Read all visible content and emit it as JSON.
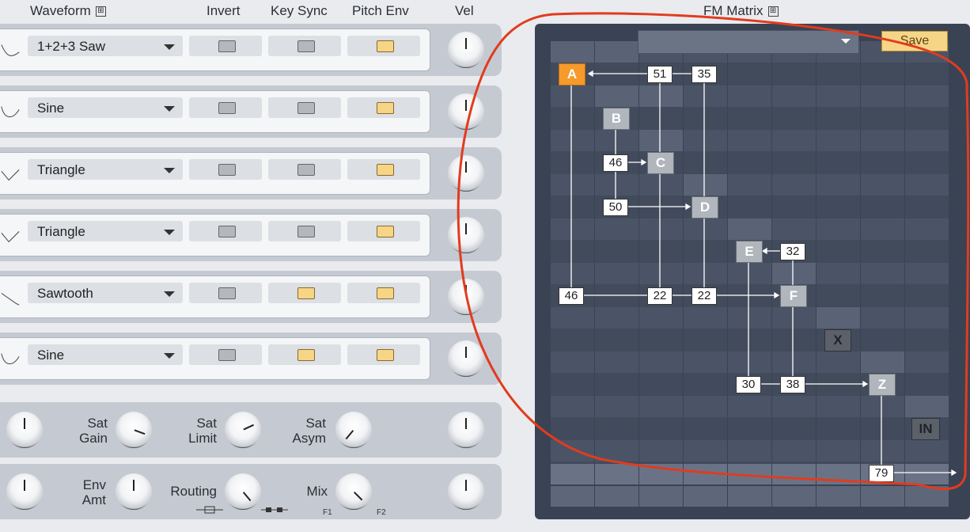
{
  "headers": {
    "waveform": "Waveform",
    "invert": "Invert",
    "key_sync": "Key Sync",
    "pitch_env": "Pitch Env",
    "vel": "Vel",
    "fm_matrix": "FM Matrix",
    "expand_glyph": "⊞"
  },
  "oscillators": [
    {
      "waveform": "1+2+3 Saw",
      "invert": false,
      "key_sync": false,
      "pitch_env": true,
      "vel": 0.5
    },
    {
      "waveform": "Sine",
      "invert": false,
      "key_sync": false,
      "pitch_env": true,
      "vel": 0.5
    },
    {
      "waveform": "Triangle",
      "invert": false,
      "key_sync": false,
      "pitch_env": true,
      "vel": 0.5
    },
    {
      "waveform": "Triangle",
      "invert": false,
      "key_sync": false,
      "pitch_env": true,
      "vel": 0.5
    },
    {
      "waveform": "Sawtooth",
      "invert": false,
      "key_sync": true,
      "pitch_env": true,
      "vel": 0.5
    },
    {
      "waveform": "Sine",
      "invert": false,
      "key_sync": true,
      "pitch_env": true,
      "vel": 0.5
    }
  ],
  "bottom_row1": {
    "sat_gain_label": "Sat\nGain",
    "sat_limit_label": "Sat\nLimit",
    "sat_asym_label": "Sat\nAsym"
  },
  "bottom_row2": {
    "env_amt_label": "Env\nAmt",
    "routing_label": "Routing",
    "mix_label": "Mix",
    "mix_f1": "F1",
    "mix_f2": "F2"
  },
  "fm_matrix": {
    "preset_value": "",
    "save_label": "Save",
    "operators": {
      "a": "A",
      "b": "B",
      "c": "C",
      "d": "D",
      "e": "E",
      "f": "F",
      "x": "X",
      "z": "Z",
      "in": "IN"
    },
    "amounts": {
      "a_from_b": "51",
      "a_from_c": "35",
      "c_from_b": "46",
      "d_from_b": "50",
      "e_from_f": "32",
      "f_from_a": "46",
      "f_from_b": "22",
      "f_from_c": "22",
      "z_from_e": "30",
      "z_from_f": "38",
      "out_from_z": "79"
    }
  },
  "colors": {
    "accent": "#f59a2b",
    "annotation": "#e23b1e",
    "toggle_on": "#f7d587"
  }
}
